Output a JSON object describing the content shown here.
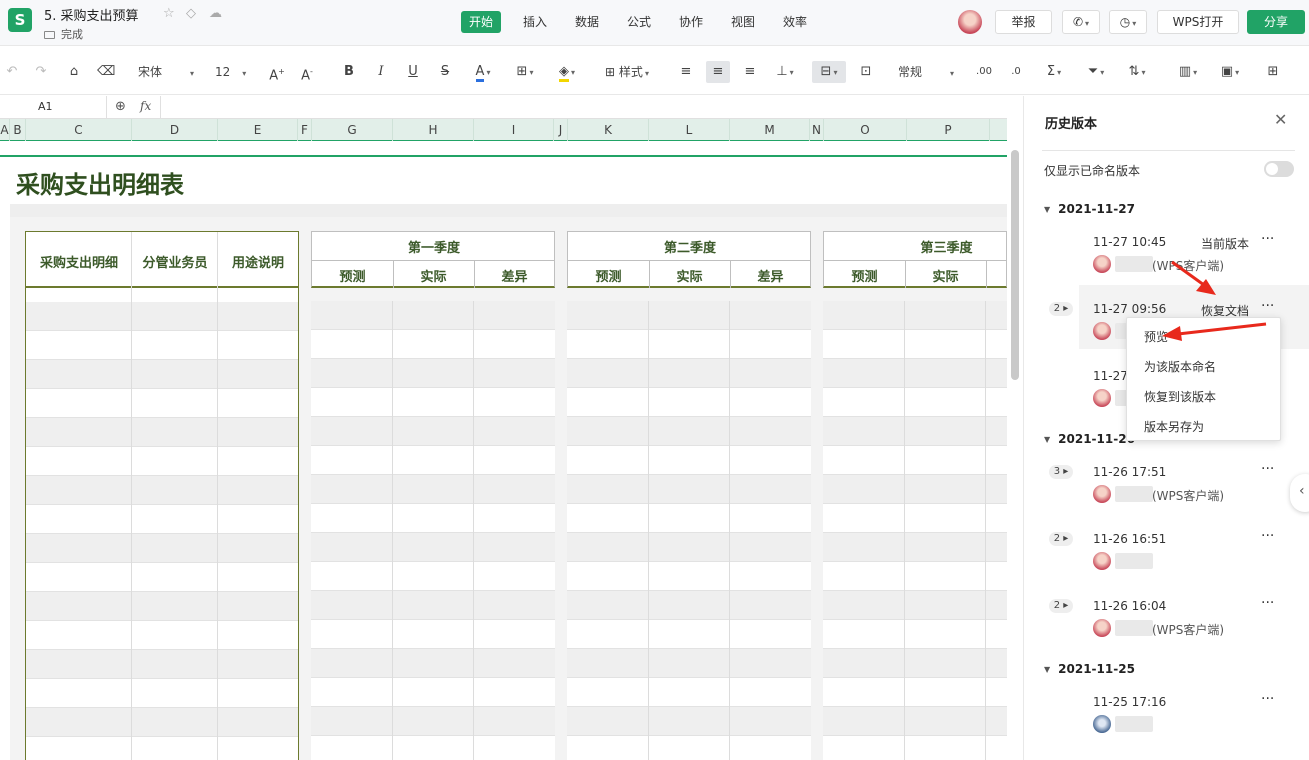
{
  "app": {
    "logo": "S",
    "title": "5. 采购支出预算",
    "status": "完成"
  },
  "menus": [
    "开始",
    "插入",
    "数据",
    "公式",
    "协作",
    "视图",
    "效率"
  ],
  "topbar": {
    "report": "举报",
    "wps_open": "WPS打开",
    "share": "分享"
  },
  "toolbar": {
    "font": "宋体",
    "size": "12",
    "style_label": "样式",
    "number_format": "常规"
  },
  "formula": {
    "cell_ref": "A1",
    "fx": "fx"
  },
  "columns": [
    "A",
    "B",
    "C",
    "D",
    "E",
    "F",
    "G",
    "H",
    "I",
    "J",
    "K",
    "L",
    "M",
    "N",
    "O",
    "P"
  ],
  "sheet": {
    "title": "采购支出明细表",
    "left_headers": [
      "采购支出明细",
      "分管业务员",
      "用途说明"
    ],
    "quarters": [
      "第一季度",
      "第二季度",
      "第三季度"
    ],
    "sub_headers": [
      "预测",
      "实际",
      "差异"
    ]
  },
  "panel": {
    "title": "历史版本",
    "filter_label": "仅显示已命名版本",
    "groups": [
      {
        "date": "2021-11-27",
        "entries": [
          {
            "time": "11-27 10:45",
            "tag": "当前版本",
            "client": "(WPS客户端)",
            "badge": ""
          },
          {
            "time": "11-27 09:56",
            "tag": "恢复文档",
            "client": "",
            "badge": "2"
          },
          {
            "time": "11-27",
            "tag": "",
            "client": "",
            "badge": ""
          }
        ]
      },
      {
        "date": "2021-11-26",
        "entries": [
          {
            "time": "11-26 17:51",
            "tag": "",
            "client": "(WPS客户端)",
            "badge": "3"
          },
          {
            "time": "11-26 16:51",
            "tag": "",
            "client": "",
            "badge": "2"
          },
          {
            "time": "11-26 16:04",
            "tag": "",
            "client": "(WPS客户端)",
            "badge": "2"
          }
        ]
      },
      {
        "date": "2021-11-25",
        "entries": [
          {
            "time": "11-25 17:16",
            "tag": "",
            "client": "",
            "badge": ""
          }
        ]
      }
    ],
    "context_menu": [
      "预览",
      "为该版本命名",
      "恢复到该版本",
      "版本另存为"
    ]
  },
  "colors": {
    "accent": "#21a366",
    "header_green": "#3c5a2a",
    "arrow": "#e8291c"
  }
}
